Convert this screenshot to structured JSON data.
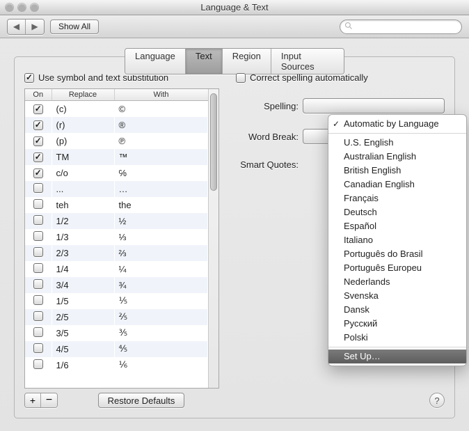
{
  "window": {
    "title": "Language & Text"
  },
  "toolbar": {
    "back_icon": "◀",
    "forward_icon": "▶",
    "show_all": "Show All",
    "search_placeholder": ""
  },
  "tabs": [
    {
      "id": "language",
      "label": "Language",
      "active": false
    },
    {
      "id": "text",
      "label": "Text",
      "active": true
    },
    {
      "id": "region",
      "label": "Region",
      "active": false
    },
    {
      "id": "input-sources",
      "label": "Input Sources",
      "active": false
    }
  ],
  "left": {
    "use_substitution_label": "Use symbol and text substitution",
    "use_substitution_checked": true,
    "headers": {
      "on": "On",
      "replace": "Replace",
      "with": "With"
    },
    "rows": [
      {
        "on": true,
        "replace": "(c)",
        "with": "©"
      },
      {
        "on": true,
        "replace": "(r)",
        "with": "®"
      },
      {
        "on": true,
        "replace": "(p)",
        "with": "℗"
      },
      {
        "on": true,
        "replace": "TM",
        "with": "™"
      },
      {
        "on": true,
        "replace": "c/o",
        "with": "℅"
      },
      {
        "on": false,
        "replace": "...",
        "with": "…"
      },
      {
        "on": false,
        "replace": "teh",
        "with": "the"
      },
      {
        "on": false,
        "replace": "1/2",
        "with": "½"
      },
      {
        "on": false,
        "replace": "1/3",
        "with": "⅓"
      },
      {
        "on": false,
        "replace": "2/3",
        "with": "⅔"
      },
      {
        "on": false,
        "replace": "1/4",
        "with": "¼"
      },
      {
        "on": false,
        "replace": "3/4",
        "with": "¾"
      },
      {
        "on": false,
        "replace": "1/5",
        "with": "⅕"
      },
      {
        "on": false,
        "replace": "2/5",
        "with": "⅖"
      },
      {
        "on": false,
        "replace": "3/5",
        "with": "⅗"
      },
      {
        "on": false,
        "replace": "4/5",
        "with": "⅘"
      },
      {
        "on": false,
        "replace": "1/6",
        "with": "⅙"
      }
    ],
    "add": "+",
    "remove": "−",
    "restore_defaults": "Restore Defaults"
  },
  "right": {
    "correct_spelling_label": "Correct spelling automatically",
    "correct_spelling_checked": false,
    "spelling_label": "Spelling:",
    "word_break_label": "Word Break:",
    "smart_quotes_label": "Smart Quotes:",
    "spelling_menu": {
      "selected": "Automatic by Language",
      "items": [
        "U.S. English",
        "Australian English",
        "British English",
        "Canadian English",
        "Français",
        "Deutsch",
        "Español",
        "Italiano",
        "Português do Brasil",
        "Português Europeu",
        "Nederlands",
        "Svenska",
        "Dansk",
        "Русский",
        "Polski"
      ],
      "setup": "Set Up…"
    }
  },
  "help": "?"
}
